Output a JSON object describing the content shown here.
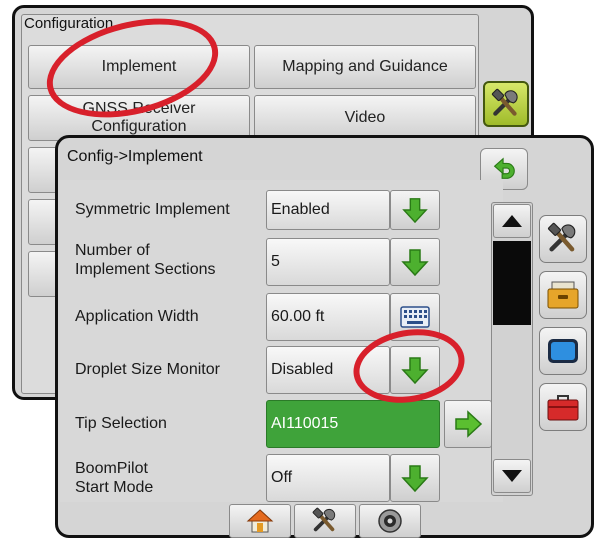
{
  "config_screen": {
    "title": "Configuration",
    "buttons": {
      "implement": "Implement",
      "mapping_guidance": "Mapping and Guidance",
      "gnss_line1": "GNSS Receiver",
      "gnss_line2": "Configuration",
      "video": "Video"
    }
  },
  "implement_screen": {
    "title": "Config->Implement",
    "rows": {
      "symmetric": {
        "label": "Symmetric Implement",
        "value": "Enabled"
      },
      "sections": {
        "label_line1": "Number of",
        "label_line2": "Implement Sections",
        "value": "5"
      },
      "width": {
        "label": "Application Width",
        "value": "60.00 ft"
      },
      "droplet": {
        "label": "Droplet Size Monitor",
        "value": "Disabled"
      },
      "tip": {
        "label": "Tip Selection",
        "value": "AI110015"
      },
      "boompilot": {
        "label_line1": "BoomPilot",
        "label_line2": "Start Mode",
        "value": "Off"
      }
    }
  },
  "icons": {
    "back": "back-arrow-icon",
    "down": "green-down-arrow-icon",
    "right": "green-right-arrow-icon",
    "keyboard": "keyboard-icon",
    "tools": "tools-icon",
    "console": "console-drawer-icon",
    "display": "display-icon",
    "toolbox": "toolbox-icon",
    "home": "home-icon",
    "settings": "settings-dial-icon"
  },
  "colors": {
    "green_value": "#3fa33a",
    "highlight_ring": "#d8202b",
    "tool_active": "#b7d03c"
  }
}
